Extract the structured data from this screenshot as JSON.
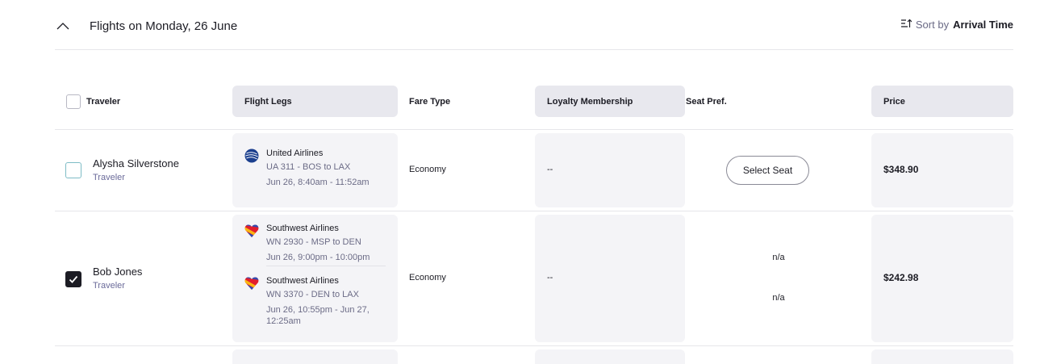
{
  "section": {
    "title": "Flights on Monday, 26 June"
  },
  "sort": {
    "label": "Sort by",
    "value": "Arrival Time"
  },
  "columns": {
    "traveler": "Traveler",
    "legs": "Flight Legs",
    "fare": "Fare Type",
    "loyalty": "Loyalty Membership",
    "seat": "Seat Pref.",
    "price": "Price"
  },
  "rows": [
    {
      "name": "Alysha Silverstone",
      "role": "Traveler",
      "checked": false,
      "legs": [
        {
          "airline": "United Airlines",
          "logo": "united-logo-icon",
          "route": "UA 311 - BOS to LAX",
          "times": "Jun 26, 8:40am - 11:52am"
        }
      ],
      "fare": "Economy",
      "loyalty": "--",
      "seat_button": "Select Seat",
      "price": "$348.90"
    },
    {
      "name": "Bob Jones",
      "role": "Traveler",
      "checked": true,
      "legs": [
        {
          "airline": "Southwest Airlines",
          "logo": "southwest-logo-icon",
          "route": "WN 2930 - MSP to DEN",
          "times": "Jun 26, 9:00pm - 10:00pm"
        },
        {
          "airline": "Southwest Airlines",
          "logo": "southwest-logo-icon",
          "route": "WN 3370 - DEN to LAX",
          "times": "Jun 26, 10:55pm - Jun 27, 12:25am"
        }
      ],
      "fare": "Economy",
      "loyalty": "--",
      "seats": [
        "n/a",
        "n/a"
      ],
      "price": "$242.98"
    }
  ]
}
